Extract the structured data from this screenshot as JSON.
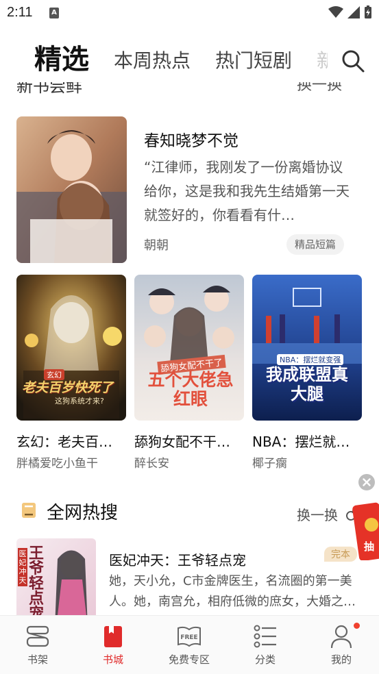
{
  "status_bar": {
    "time": "2:11",
    "notification_letter": "A"
  },
  "top_tabs": {
    "active": "精选",
    "items": [
      "本周热点",
      "热门短剧",
      "新"
    ]
  },
  "clipped_section": {
    "title": "新书尝鲜",
    "refresh": "换一换"
  },
  "featured": {
    "title": "春知晓梦不觉",
    "description": "“江律师，我刚发了一份离婚协议给你，这是我和我先生结婚第一天就签好的，你看看有什…",
    "author": "朝朝",
    "tag": "精品短篇"
  },
  "book_grid": [
    {
      "title": "玄幻：老夫百…",
      "author": "胖橘爱吃小鱼干",
      "cover_text": "老夫百岁快死了",
      "cover_sub": "这狗系统才来?",
      "cover_tag": "玄幻"
    },
    {
      "title": "舔狗女配不干…",
      "author": "醉长安",
      "cover_text": "五个大佬急红眼",
      "cover_sub": "舔狗女配不干了",
      "cover_tag": ""
    },
    {
      "title": "NBA：摆烂就…",
      "author": "椰子瘸",
      "cover_text": "我成联盟真大腿",
      "cover_sub": "NBA：摆烂就变强",
      "cover_tag": ""
    }
  ],
  "hot_search": {
    "title": "全网热搜",
    "refresh": "换一换",
    "item": {
      "title": "医妃冲天：王爷轻点宠",
      "description": "她，天小允，C市金牌医生，名流圈的第一美人。她，南宫允，相府低微的庶女，大婚之…",
      "badge": "完本",
      "cover_text": "王爷轻点宠",
      "cover_tag": "医妃冲天"
    }
  },
  "red_envelope": {
    "label": "抽"
  },
  "bottom_nav": [
    {
      "label": "书架",
      "icon": "bookshelf-icon"
    },
    {
      "label": "书城",
      "icon": "bookstore-icon",
      "active": true
    },
    {
      "label": "免费专区",
      "icon": "free-book-icon",
      "icon_text": "FREE"
    },
    {
      "label": "分类",
      "icon": "category-icon"
    },
    {
      "label": "我的",
      "icon": "profile-icon",
      "dot": true
    }
  ],
  "colors": {
    "accent": "#e02b2b",
    "badge_bg": "#f5e3c8",
    "badge_text": "#c89b56"
  }
}
